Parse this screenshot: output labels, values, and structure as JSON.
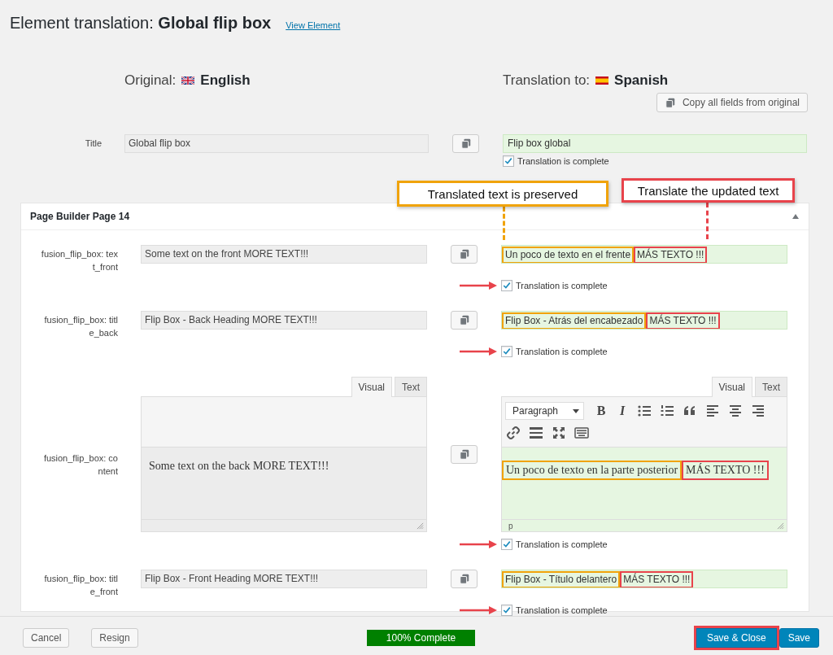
{
  "header": {
    "title": "Element translation: **Global flip box**",
    "link": "View Element"
  },
  "languages": {
    "original_label": "Original:",
    "original": "English",
    "translation_label": "Translation to:",
    "translation": "Spanish"
  },
  "copy_all_button": "Copy all fields from original",
  "title_field": {
    "kind": "line",
    "label": "Title",
    "original": "Global flip box",
    "translation": [
      {
        "text": "Flip box global"
      }
    ],
    "complete_label": "Translation is complete",
    "complete": true,
    "arrow": false
  },
  "callouts": [
    {
      "text": "Translated text is preserved",
      "color": "#f0a30a"
    },
    {
      "text": "Translate the updated text",
      "color": "#e8434b"
    }
  ],
  "section": {
    "title": "Page Builder Page 14",
    "expanded": true,
    "fields": [
      {
        "kind": "line",
        "label": "fusion_flip_box: text_front",
        "original": "Some text on the front MORE TEXT!!!",
        "translation": [
          {
            "text": "Un poco de texto en el frente",
            "color": "#f0a30a"
          },
          {
            "text": "MÁS TEXTO !!!",
            "color": "#e8434b"
          }
        ],
        "complete_label": "Translation is complete",
        "complete": true,
        "arrow": true
      },
      {
        "kind": "line",
        "label": "fusion_flip_box: title_back",
        "original": "Flip Box - Back Heading MORE TEXT!!!",
        "translation": [
          {
            "text": "Flip Box - Atrás del encabezado",
            "color": "#f0a30a"
          },
          {
            "text": "MÁS TEXTO !!!",
            "color": "#e8434b"
          }
        ],
        "complete_label": "Translation is complete",
        "complete": true,
        "arrow": true
      },
      {
        "kind": "editor",
        "label": "fusion_flip_box: content",
        "original_tabs": [
          {
            "label": "Visual",
            "selected": true
          },
          {
            "label": "Text",
            "selected": false
          }
        ],
        "translation_tabs": [
          {
            "label": "Visual",
            "selected": true
          },
          {
            "label": "Text",
            "selected": false
          }
        ],
        "toolbar": {
          "format": "Paragraph",
          "buttons": [
            {
              "kind": "bold",
              "glyph": "B"
            },
            {
              "kind": "italic",
              "glyph": "I"
            },
            {
              "kind": "bullet-list"
            },
            {
              "kind": "numbered-list"
            },
            {
              "kind": "quote"
            },
            {
              "kind": "align-left"
            },
            {
              "kind": "align-center"
            },
            {
              "kind": "align-right"
            },
            {
              "kind": "link"
            },
            {
              "kind": "horizontal-line"
            },
            {
              "kind": "fullscreen"
            },
            {
              "kind": "keyboard"
            }
          ]
        },
        "original": "Some text on the back MORE TEXT!!!",
        "translation": [
          {
            "text": "Un poco de texto en la parte posterior",
            "color": "#f0a30a"
          },
          {
            "text": "MÁS TEXTO !!!",
            "color": "#e8434b"
          }
        ],
        "status": "p",
        "complete_label": "Translation is complete",
        "complete": true,
        "arrow": true
      },
      {
        "kind": "line",
        "label": "fusion_flip_box: title_front",
        "original": "Flip Box - Front Heading MORE TEXT!!!",
        "translation": [
          {
            "text": "Flip Box - Título delantero",
            "color": "#f0a30a"
          },
          {
            "text": "MÁS TEXTO !!!",
            "color": "#e8434b"
          }
        ],
        "complete_label": "Translation is complete",
        "complete": true,
        "arrow": true
      }
    ]
  },
  "footer": {
    "buttons_left": [
      "Cancel",
      "Resign"
    ],
    "progress": {
      "label": "100% Complete",
      "level": 1
    },
    "buttons_right": [
      {
        "label": "Save & Close",
        "outlined": true
      },
      {
        "label": "Save",
        "outlined": false
      }
    ]
  }
}
